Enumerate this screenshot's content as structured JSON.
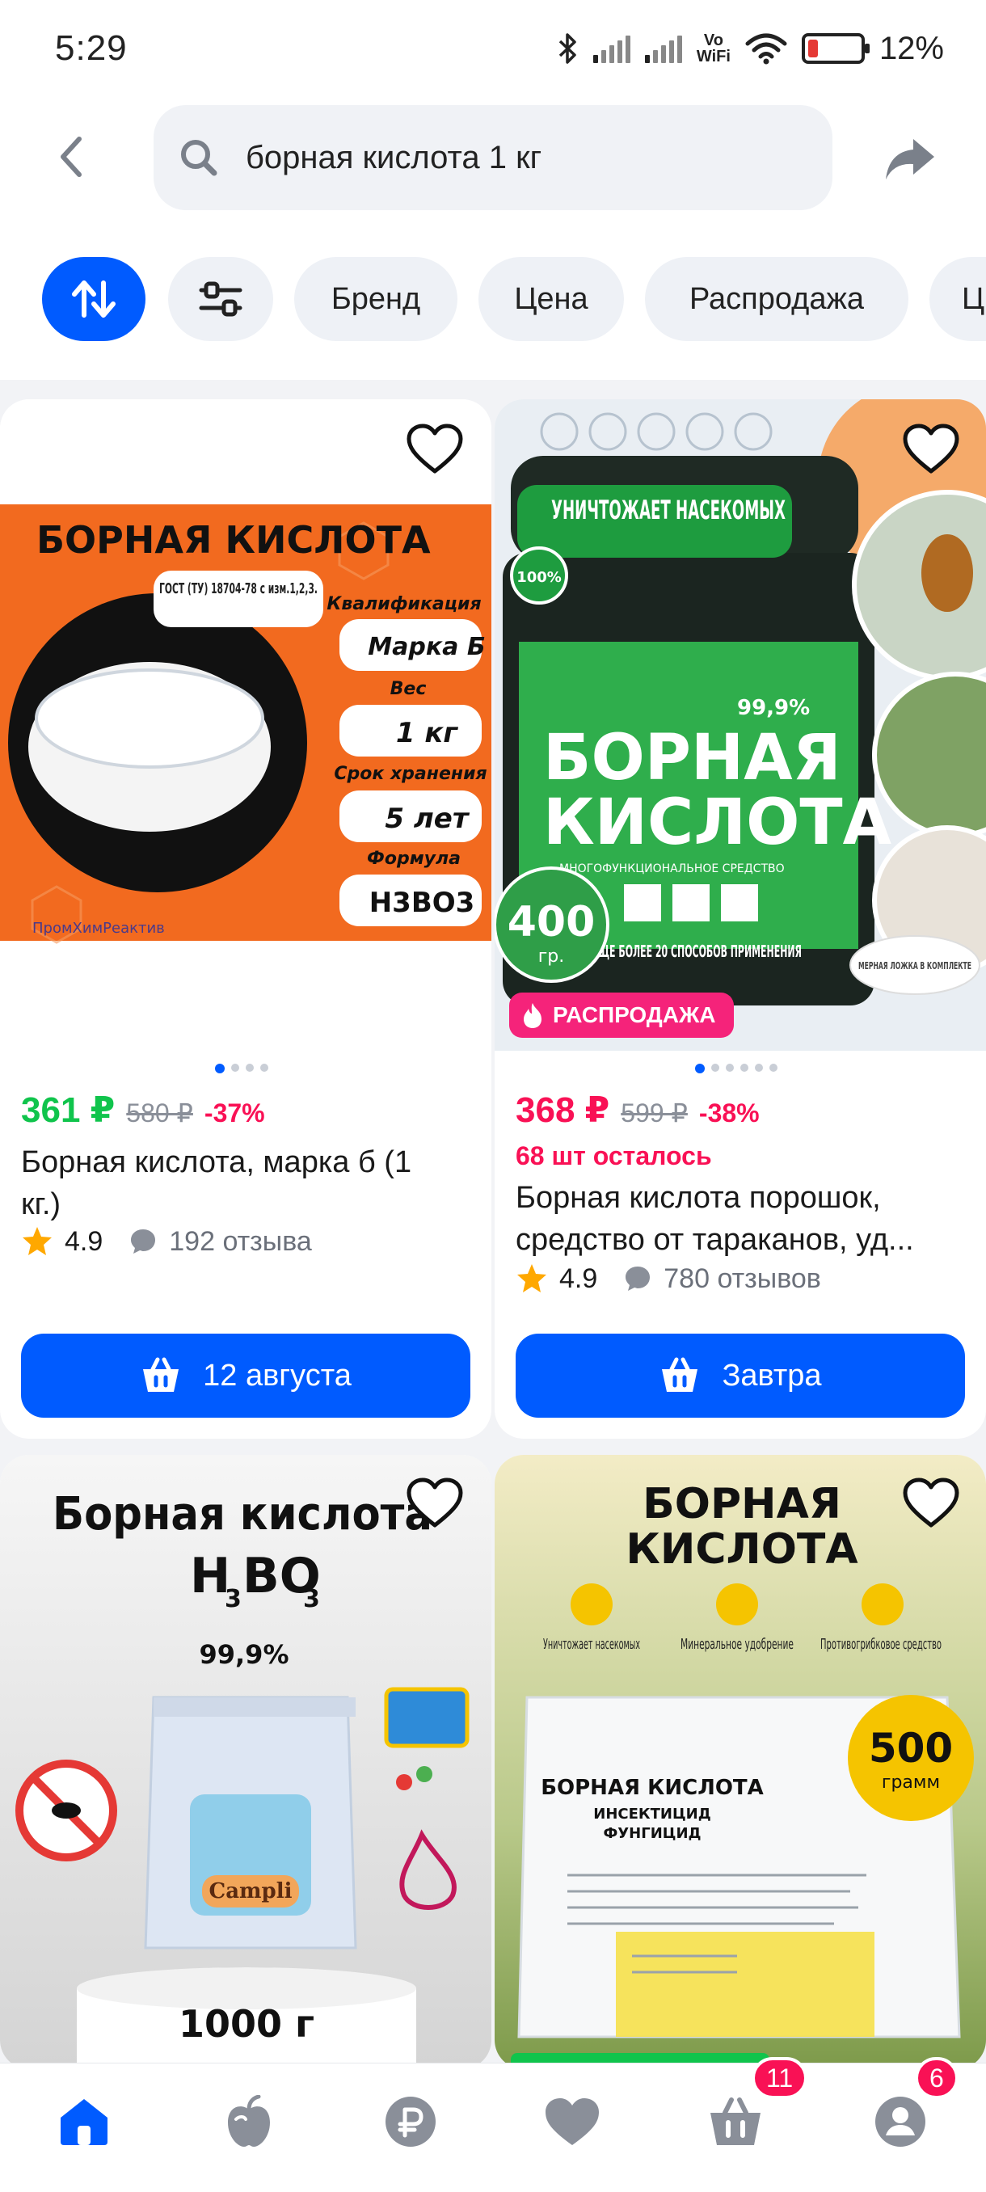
{
  "status_bar": {
    "time": "5:29",
    "vowifi_top": "Vo",
    "vowifi_bottom": "WiFi",
    "battery": "12%"
  },
  "search": {
    "query": "борная кислота 1 кг"
  },
  "filters": {
    "chips": [
      "Бренд",
      "Цена",
      "Распродажа",
      "Ц"
    ]
  },
  "products": [
    {
      "image_texts": {
        "heading": "БОРНАЯ КИСЛОТА",
        "gost": "ГОСТ (ТУ) 18704-78 с изм.1,2,3.",
        "q_label": "Квалификация",
        "q_value": "Марка Б",
        "w_label": "Вес",
        "w_value": "1 кг",
        "s_label": "Срок хранения",
        "s_value": "5 лет",
        "f_label": "Формула",
        "f_value": "H3BO3",
        "brand": "ПромХимРеактив"
      },
      "price": "361 ₽",
      "old_price": "580 ₽",
      "discount": "-37%",
      "title": "Борная кислота, марка б (1 кг.)",
      "rating": "4.9",
      "reviews": "192 отзыва",
      "button": "12 августа",
      "price_color": "#10c44c"
    },
    {
      "image_texts": {
        "stamp": "100%",
        "banner": "УНИЧТОЖАЕТ НАСЕКОМЫХ",
        "purity": "99,9%",
        "heading1": "БОРНАЯ",
        "heading2": "КИСЛОТА",
        "subtitle": "МНОГОФУНКЦИОНАЛЬНОЕ СРЕДСТВО",
        "weight": "400",
        "weight_unit": "гр.",
        "note": "ЕЩЕ БОЛЕЕ 20 СПОСОБОВ ПРИМЕНЕНИЯ",
        "scoop": "МЕРНАЯ ЛОЖКА В КОМПЛЕКТЕ"
      },
      "sale_badge": "РАСПРОДАЖА",
      "price": "368 ₽",
      "old_price": "599 ₽",
      "discount": "-38%",
      "stock": "68 шт осталось",
      "title": "Борная кислота порошок, средство от тараканов, уд...",
      "rating": "4.9",
      "reviews": "780 отзывов",
      "button": "Завтра",
      "price_color": "#f91155"
    },
    {
      "image_texts": {
        "heading": "Борная кислота",
        "formula_h": "H",
        "formula_h_sub": "3",
        "formula_bo": "BO",
        "formula_o_sub": "3",
        "purity": "99,9%",
        "brand": "Campli",
        "weight": "1000 г"
      }
    },
    {
      "image_texts": {
        "heading1": "БОРНАЯ",
        "heading2": "КИСЛОТА",
        "feature1": "Уничтожает насекомых",
        "feature2": "Минеральное удобрение",
        "feature3": "Противогрибковое средство",
        "weight": "500",
        "weight_unit": "грамм",
        "pack_title": "БОРНАЯ КИСЛОТА",
        "pack_sub1": "ИНСЕКТИЦИД",
        "pack_sub2": "ФУНГИЦИД"
      }
    }
  ],
  "bottom_nav": {
    "cart_badge": "11",
    "profile_badge": "6"
  },
  "colors": {
    "accent": "#005bff",
    "sale": "#f91155",
    "rating_star": "#ffa800"
  }
}
